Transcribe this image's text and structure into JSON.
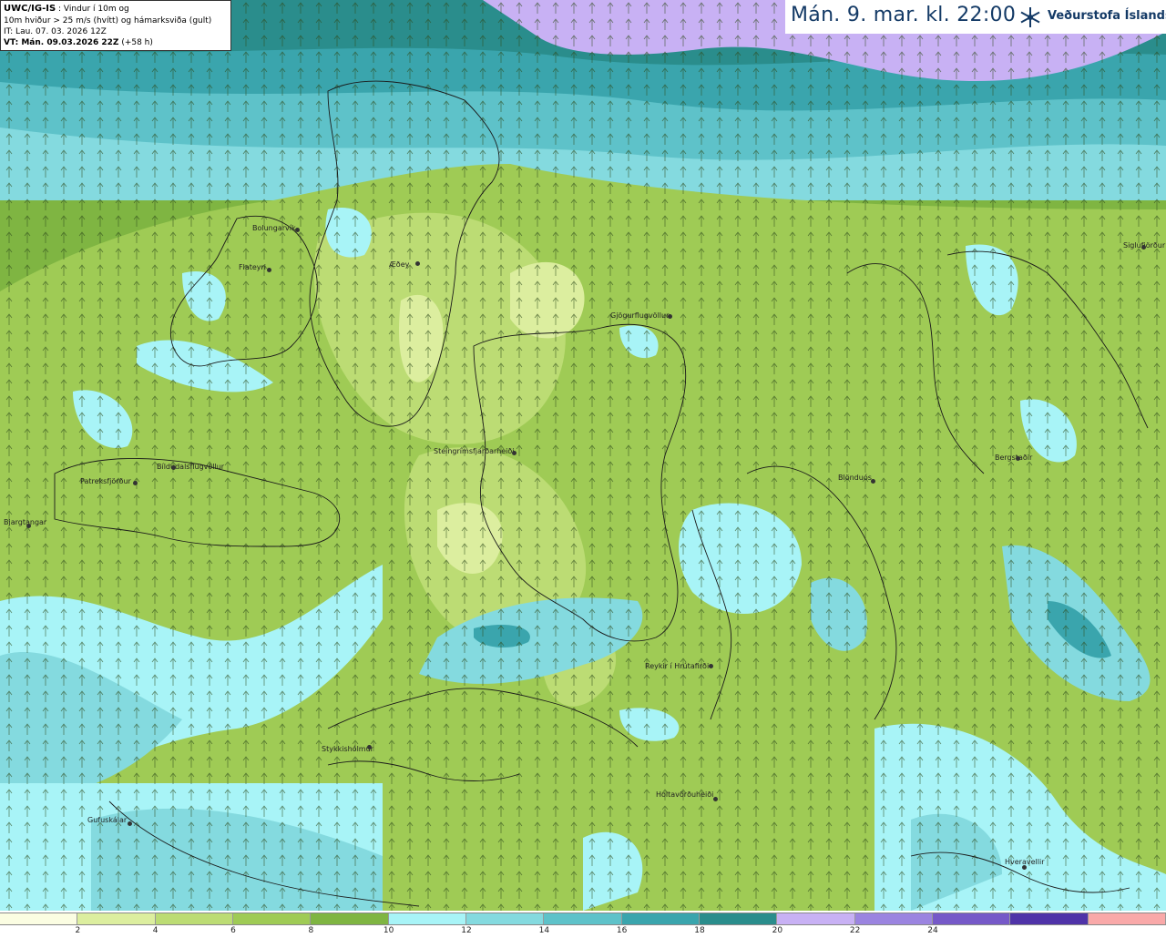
{
  "info": {
    "model": "UWC/IG-IS",
    "desc1": " : Vindur í 10m og",
    "desc2": "10m hviður > 25 m/s (hvítt) og hámarksviða (gult)",
    "it_line": "IT: Lau. 07. 03. 2026 12Z",
    "vt_label": "VT: Mán. 09.03.2026 22Z",
    "vt_offset": " (+58 h)"
  },
  "title": {
    "text": "Mán. 9. mar. kl. 22:00",
    "logo_text": "Veðurstofa Íslands",
    "logo_icon": "snowflake-icon"
  },
  "places": [
    {
      "name": "Bolungarvík"
    },
    {
      "name": "Flateyri"
    },
    {
      "name": "Æðey"
    },
    {
      "name": "Gjögurflugvöllur"
    },
    {
      "name": "Siglufjörður"
    },
    {
      "name": "Steingrímsfjarðarheiði"
    },
    {
      "name": "Bíldudalsflugvöllur"
    },
    {
      "name": "Patreksfjörður"
    },
    {
      "name": "Bjargtangar"
    },
    {
      "name": "Blönduós"
    },
    {
      "name": "Bergstaðir"
    },
    {
      "name": "Reykir í Hrútafirði"
    },
    {
      "name": "Stykkishólmur"
    },
    {
      "name": "Holtavörðuheiði"
    },
    {
      "name": "Gufuskálar"
    },
    {
      "name": "Hveravellir"
    }
  ],
  "legend": {
    "colors": [
      "#fbfde2",
      "#dcee9f",
      "#bcdc74",
      "#9fcb55",
      "#7fb542",
      "#a8f4f7",
      "#84dadf",
      "#5ec2c9",
      "#3aa5ad",
      "#2a8d8c",
      "#c8b1f4",
      "#9b84e0",
      "#7659c8",
      "#4f33a8",
      "#f9a9a9"
    ],
    "ticks": [
      "2",
      "4",
      "6",
      "8",
      "10",
      "12",
      "14",
      "16",
      "18",
      "20",
      "22",
      "24"
    ]
  }
}
